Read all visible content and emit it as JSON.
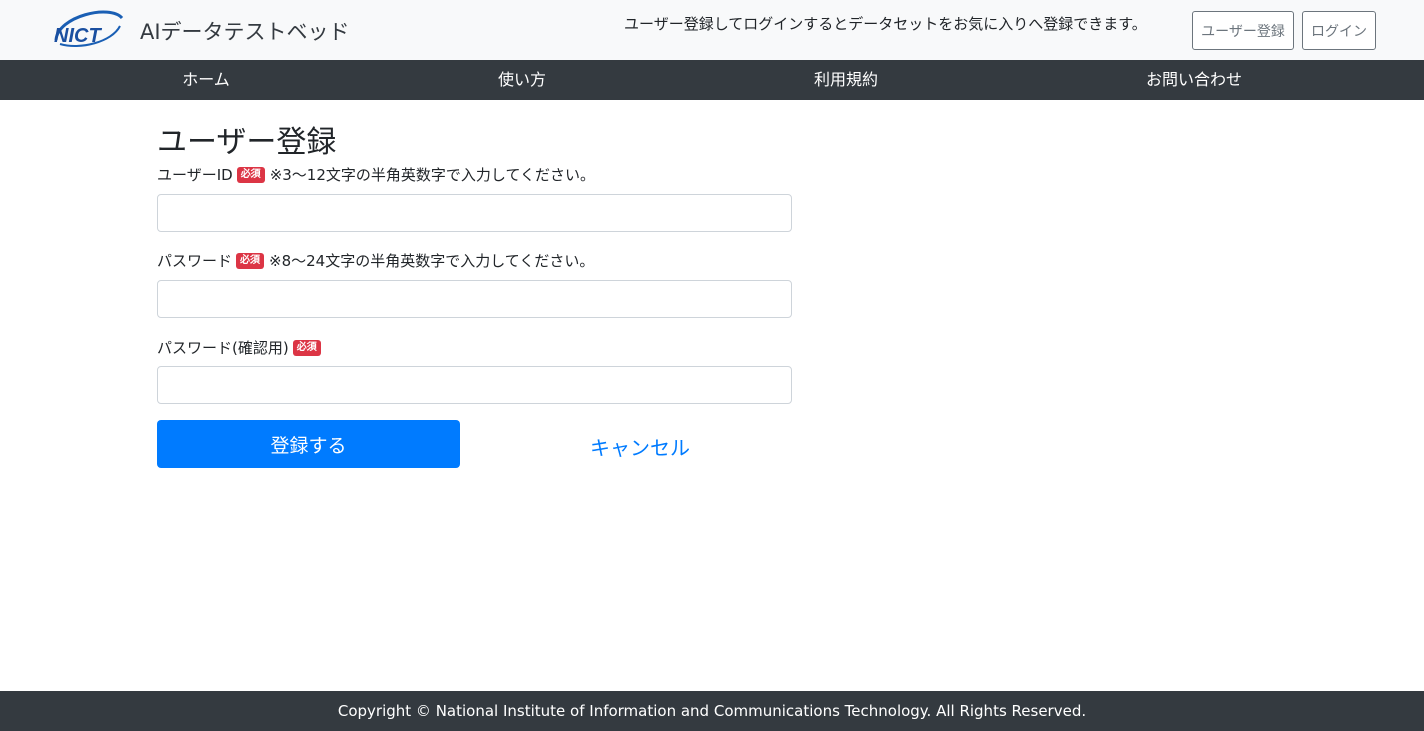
{
  "header": {
    "logo_text": "NICT",
    "site_title": "AIデータテストベッド",
    "message": "ユーザー登録してログインするとデータセットをお気に入りへ登録できます。",
    "register_button": "ユーザー登録",
    "login_button": "ログイン"
  },
  "nav": {
    "items": [
      {
        "label": "ホーム"
      },
      {
        "label": "使い方"
      },
      {
        "label": "利用規約"
      },
      {
        "label": "お問い合わせ"
      }
    ]
  },
  "form": {
    "title": "ユーザー登録",
    "required_badge": "必須",
    "fields": [
      {
        "label": "ユーザーID",
        "hint": "※3～12文字の半角英数字で入力してください。",
        "value": ""
      },
      {
        "label": "パスワード",
        "hint": "※8～24文字の半角英数字で入力してください。",
        "value": ""
      },
      {
        "label": "パスワード(確認用)",
        "hint": "",
        "value": ""
      }
    ],
    "submit_label": "登録する",
    "cancel_label": "キャンセル"
  },
  "footer": {
    "copyright": "Copyright © National Institute of Information and Communications Technology. All Rights Reserved."
  },
  "colors": {
    "primary": "#007bff",
    "dark": "#343a40",
    "danger": "#dc3545",
    "light": "#f8f9fa"
  }
}
